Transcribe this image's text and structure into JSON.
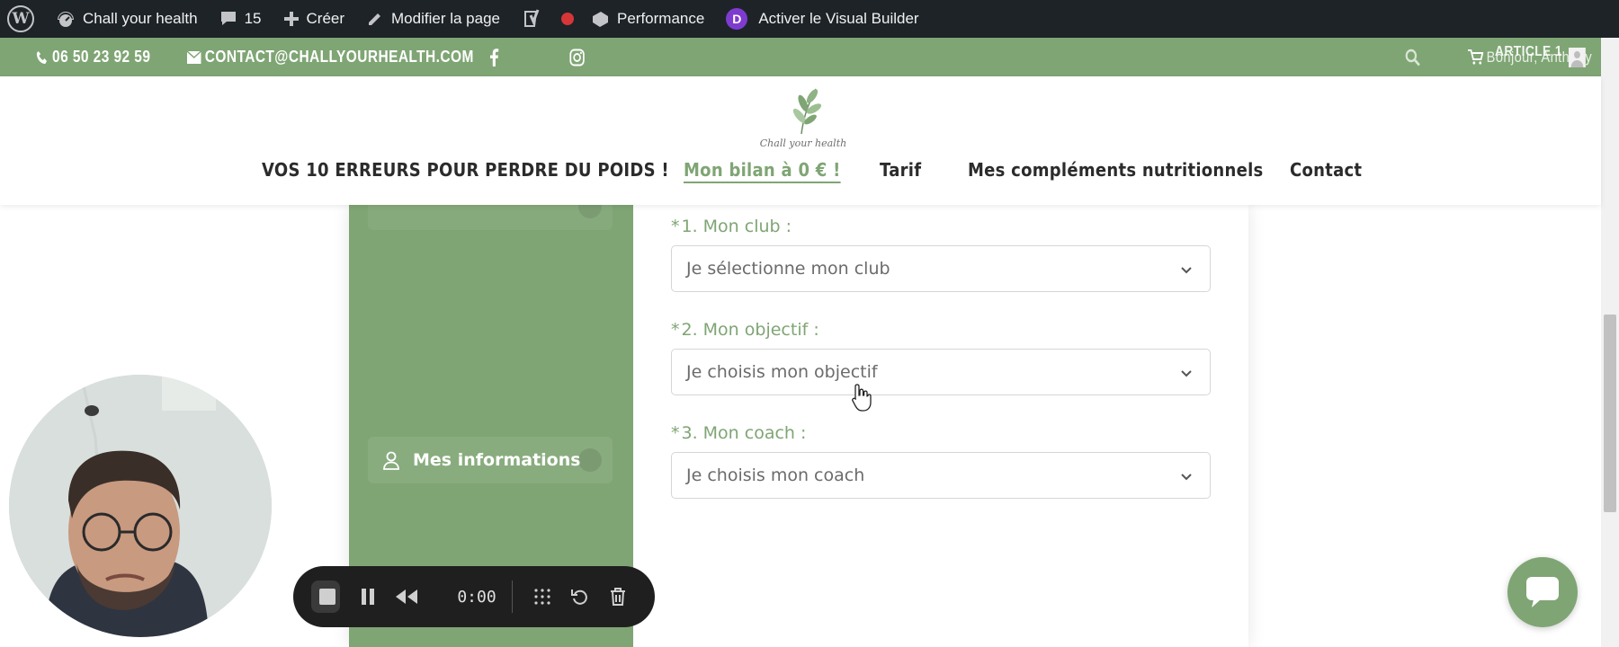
{
  "adminbar": {
    "site_name": "Chall your health",
    "comments_count": "15",
    "new_label": "Créer",
    "edit_label": "Modifier la page",
    "performance_label": "Performance",
    "divi_label": "Activer le Visual Builder",
    "divi_letter": "D"
  },
  "topbar": {
    "phone": "06 50 23 92 59",
    "email": "CONTACT@CHALLYOURHEALTH.COM",
    "greeting": "Bonjour, Anthony",
    "cart_label": "ARTICLE 1"
  },
  "header": {
    "logo_script": "Chall your health",
    "nav": [
      {
        "label": "VOS 10 ERREURS POUR PERDRE DU POIDS !"
      },
      {
        "label": "Mon bilan à 0 € !"
      },
      {
        "label": "Tarif"
      },
      {
        "label": "Mes compléments nutritionnels"
      },
      {
        "label": "Contact"
      }
    ]
  },
  "sidebar": {
    "items": [
      {
        "label": "Mes informations",
        "icon": "user-icon"
      }
    ]
  },
  "form": {
    "fields": [
      {
        "label": "1. Mon club :",
        "placeholder": "Je sélectionne mon club"
      },
      {
        "label": "2. Mon objectif :",
        "placeholder": "Je choisis mon objectif"
      },
      {
        "label": "3. Mon coach :",
        "placeholder": "Je choisis mon coach"
      }
    ],
    "required_mark": "*"
  },
  "recorder": {
    "time": "0:00"
  },
  "colors": {
    "brand_green": "#7fa574",
    "admin_bar": "#1d2327"
  }
}
